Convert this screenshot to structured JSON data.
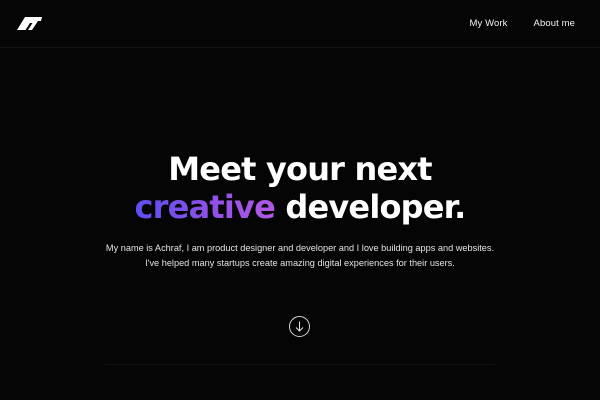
{
  "brand": {
    "logo_icon": "brand-logo-icon"
  },
  "nav": {
    "items": [
      {
        "label": "My Work"
      },
      {
        "label": "About me"
      }
    ]
  },
  "hero": {
    "title_line1": "Meet your next",
    "title_highlight": "creative",
    "title_line2_rest": "developer.",
    "description_line1": "My name is Achraf, I am product designer and developer and I love building apps and websites.",
    "description_line2": "I've helped many startups create amazing digital experiences for their users."
  },
  "scroll": {
    "icon": "arrow-down-icon"
  },
  "colors": {
    "background": "#050505",
    "text": "#ffffff",
    "gradient_start": "#5b50f0",
    "gradient_end": "#b259e6"
  }
}
